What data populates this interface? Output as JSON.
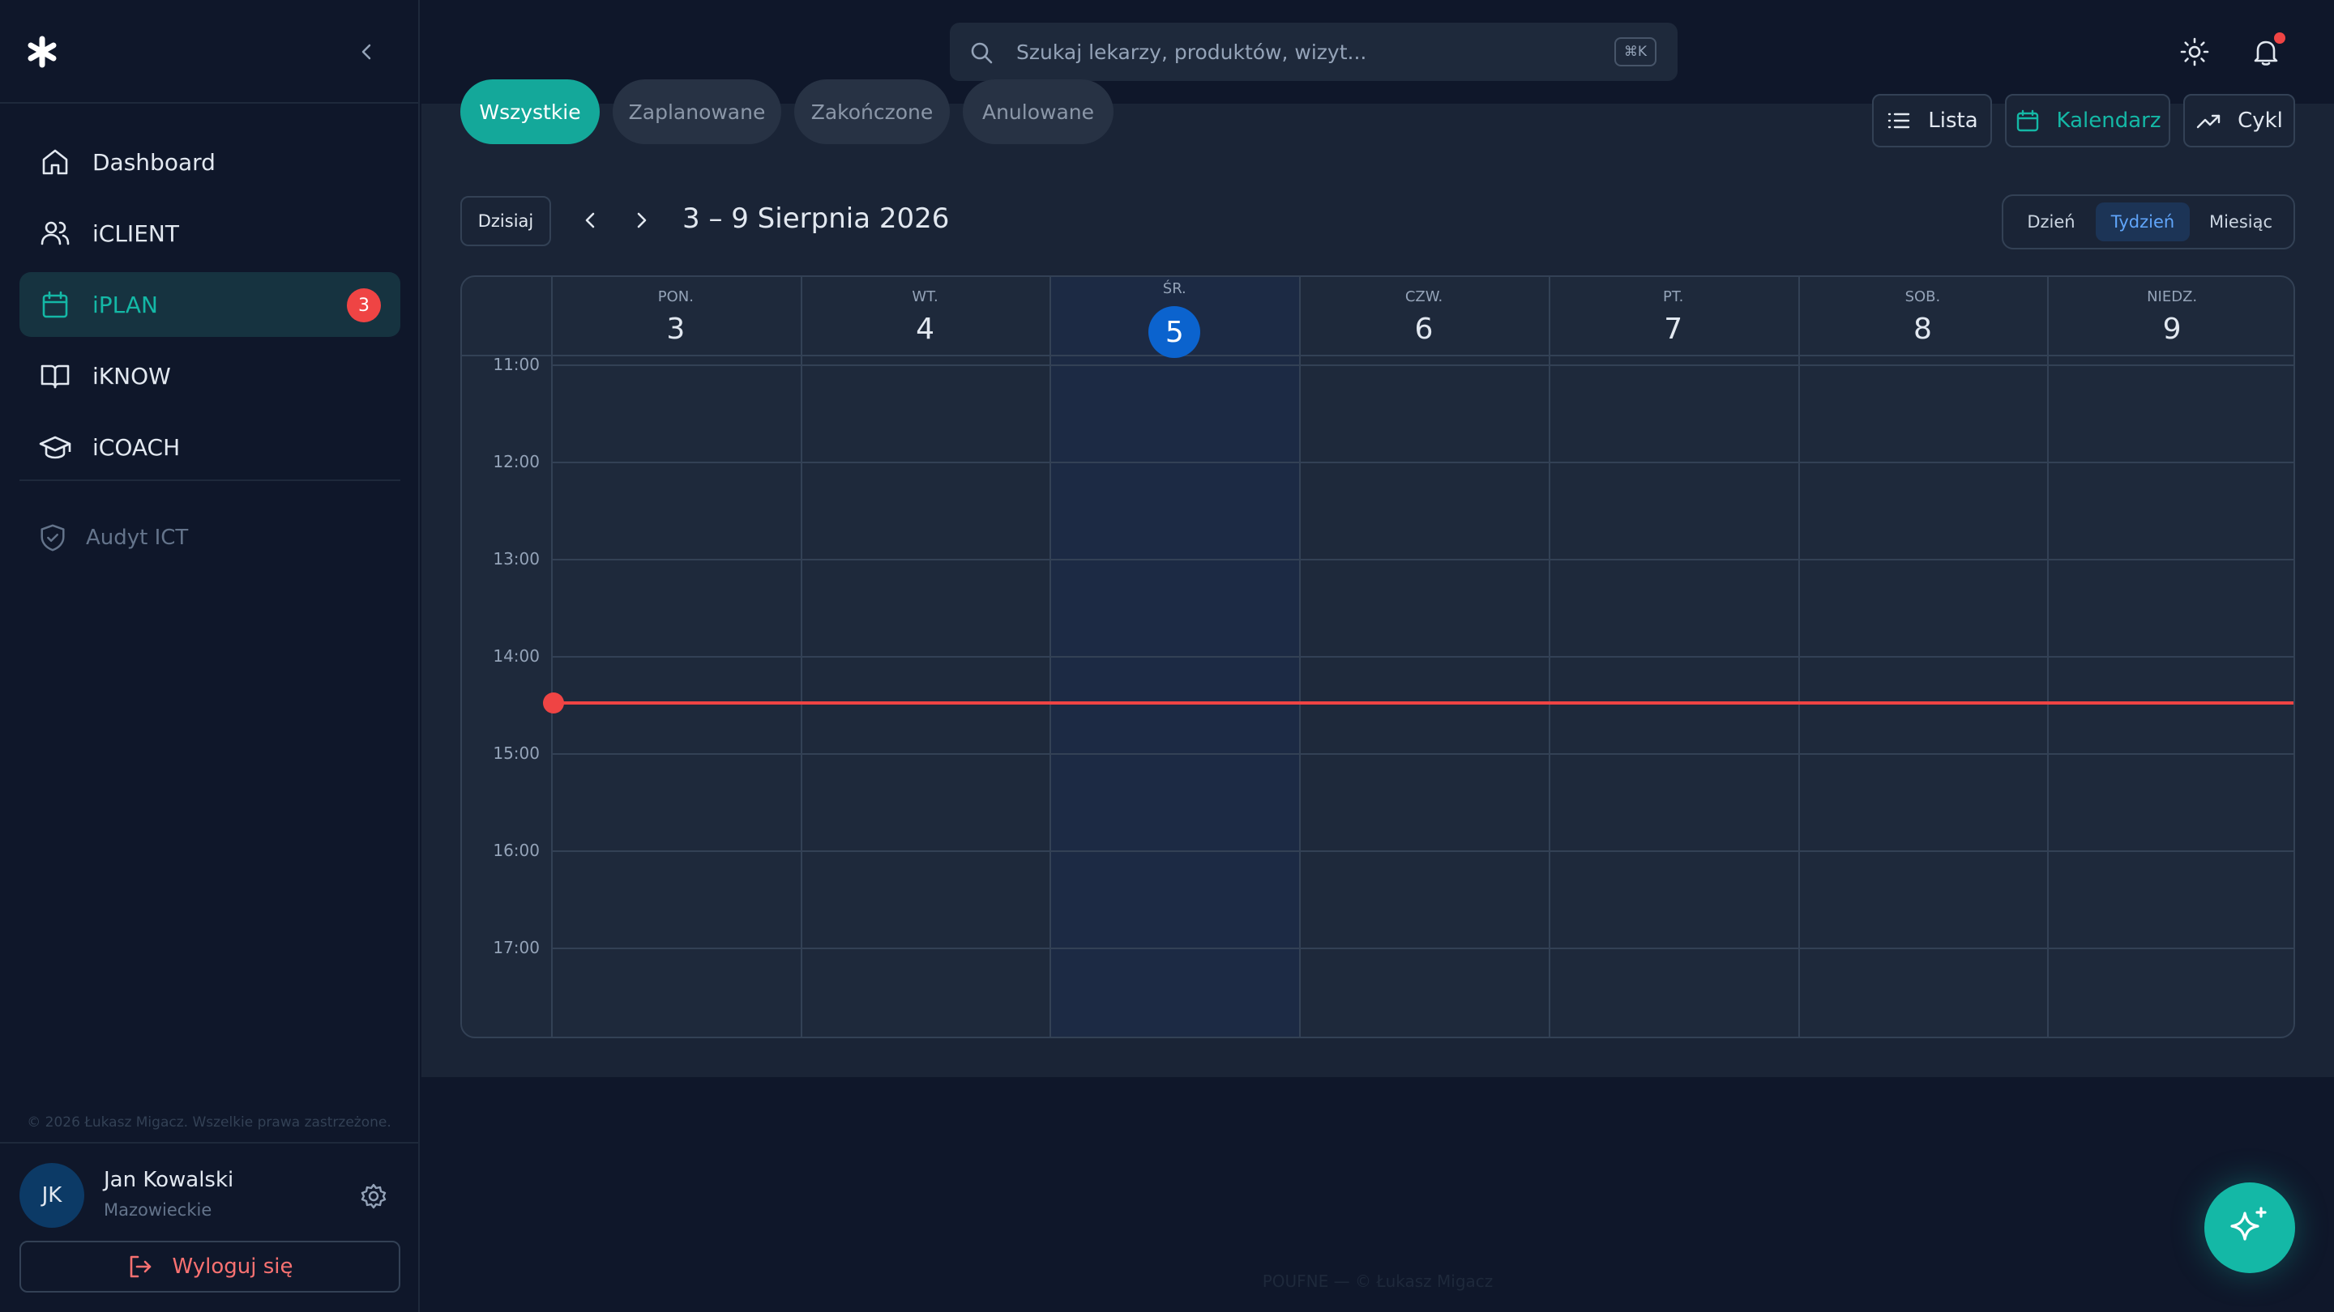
{
  "app": {
    "search_placeholder": "Szukaj lekarzy, produktów, wizyt...",
    "search_shortcut": "⌘K",
    "footer": "POUFNE — © Łukasz Migacz",
    "accent": "#14b8a6"
  },
  "sidebar": {
    "items": [
      {
        "label": "Dashboard",
        "icon": "home-icon"
      },
      {
        "label": "iCLIENT",
        "icon": "users-icon"
      },
      {
        "label": "iPLAN",
        "icon": "calendar-icon",
        "badge": "3",
        "active": true
      },
      {
        "label": "iKNOW",
        "icon": "book-icon"
      },
      {
        "label": "iCOACH",
        "icon": "graduation-cap-icon"
      }
    ],
    "audyt_label": "Audyt ICT",
    "copyright": "© 2026 Łukasz Migacz. Wszelkie prawa zastrzeżone.",
    "user": {
      "initials": "JK",
      "name": "Jan Kowalski",
      "region": "Mazowieckie"
    },
    "logout_label": "Wyloguj się"
  },
  "filters": [
    "Wszystkie",
    "Zaplanowane",
    "Zakończone",
    "Anulowane"
  ],
  "views": {
    "list": "Lista",
    "calendar": "Kalendarz",
    "cycle": "Cykl"
  },
  "calendar": {
    "today_label": "Dzisiaj",
    "range": "3 – 9 Sierpnia 2026",
    "modes": {
      "day": "Dzień",
      "week": "Tydzień",
      "month": "Miesiąc"
    },
    "days": [
      {
        "name": "PON.",
        "num": "3"
      },
      {
        "name": "WT.",
        "num": "4"
      },
      {
        "name": "ŚR.",
        "num": "5",
        "today": true
      },
      {
        "name": "CZW.",
        "num": "6"
      },
      {
        "name": "PT.",
        "num": "7"
      },
      {
        "name": "SOB.",
        "num": "8"
      },
      {
        "name": "NIEDZ.",
        "num": "9"
      }
    ],
    "hours": [
      "11:00",
      "12:00",
      "13:00",
      "14:00",
      "15:00",
      "16:00",
      "17:00"
    ],
    "now_time": "14:30"
  }
}
